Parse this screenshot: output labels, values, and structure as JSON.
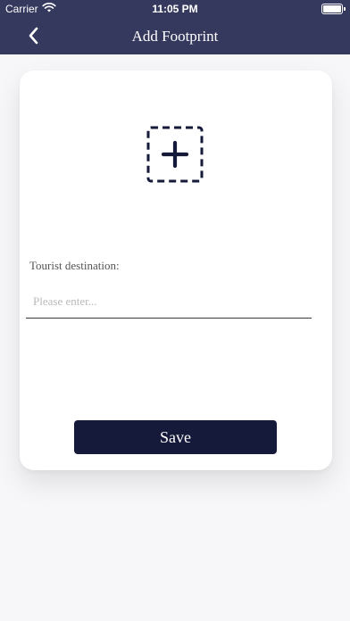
{
  "status_bar": {
    "carrier": "Carrier",
    "time": "11:05 PM"
  },
  "nav": {
    "title": "Add Footprint",
    "back_icon": "chevron-left-icon"
  },
  "form": {
    "add_photo_icon": "add-image-icon",
    "destination_label": "Tourist destination:",
    "destination_placeholder": "Please enter...",
    "destination_value": "",
    "save_label": "Save"
  },
  "colors": {
    "header": "#36395e",
    "button": "#161a3a",
    "background": "#f7f7f9",
    "card": "#ffffff"
  }
}
